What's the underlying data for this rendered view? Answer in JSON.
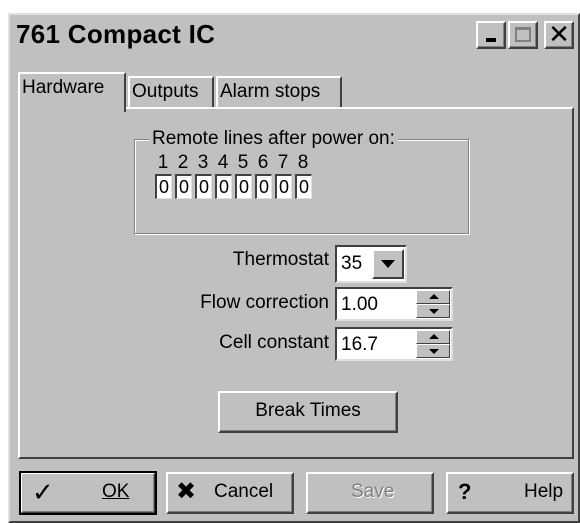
{
  "window": {
    "title": "761 Compact IC"
  },
  "titlebar": {
    "minimize_icon": "minimize-icon",
    "maximize_icon": "maximize-icon",
    "close_glyph": "✕"
  },
  "tabs": [
    {
      "label": "Hardware",
      "active": true
    },
    {
      "label": "Outputs",
      "active": false
    },
    {
      "label": "Alarm stops",
      "active": false
    }
  ],
  "remote_lines": {
    "legend": "Remote lines after power on:",
    "numbers": [
      "1",
      "2",
      "3",
      "4",
      "5",
      "6",
      "7",
      "8"
    ],
    "values": [
      "0",
      "0",
      "0",
      "0",
      "0",
      "0",
      "0",
      "0"
    ]
  },
  "thermostat": {
    "label": "Thermostat",
    "value": "35"
  },
  "flow_correction": {
    "label": "Flow correction",
    "value": "1.00"
  },
  "cell_constant": {
    "label": "Cell constant",
    "value": "16.7"
  },
  "break_times_button": "Break Times",
  "buttons": {
    "ok": {
      "label": "OK",
      "icon": "checkmark-icon"
    },
    "cancel": {
      "label": "Cancel",
      "icon": "x-icon"
    },
    "save": {
      "label": "Save",
      "disabled": true
    },
    "help": {
      "label": "Help",
      "icon": "question-icon"
    }
  },
  "colors": {
    "face": "#c0c0c0",
    "highlight": "#ffffff",
    "shadow": "#404040",
    "disabled_text": "#808080"
  }
}
